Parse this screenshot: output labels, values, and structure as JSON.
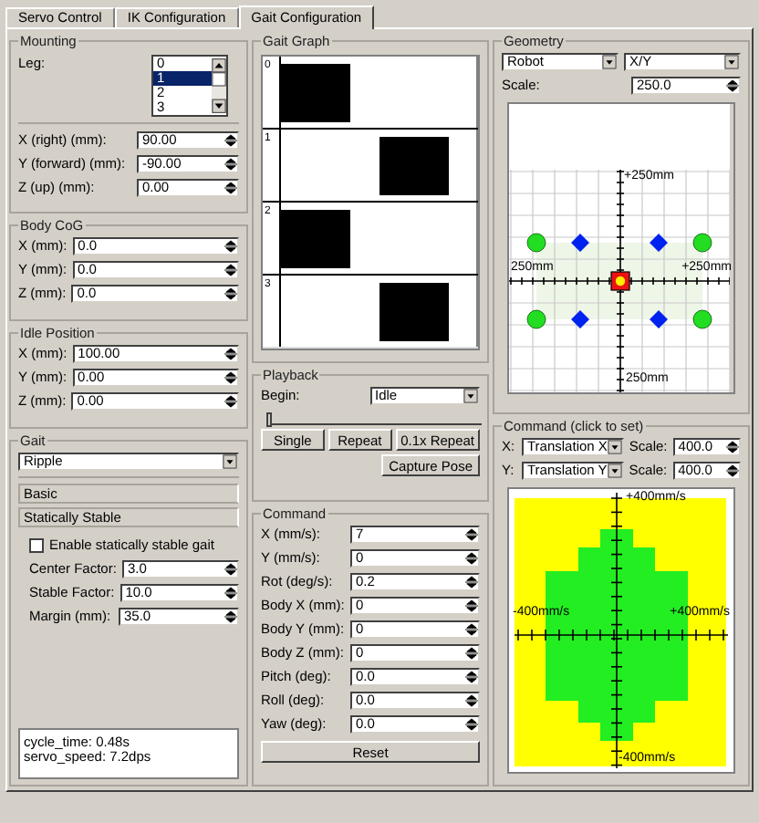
{
  "tabs": [
    {
      "label": "Servo Control",
      "selected": false
    },
    {
      "label": "IK Configuration",
      "selected": false
    },
    {
      "label": "Gait Configuration",
      "selected": true
    }
  ],
  "mounting": {
    "title": "Mounting",
    "leg_label": "Leg:",
    "legs": [
      {
        "label": "0",
        "selected": false
      },
      {
        "label": "1",
        "selected": true
      },
      {
        "label": "2",
        "selected": false
      },
      {
        "label": "3",
        "selected": false
      }
    ],
    "fields": [
      {
        "label": "X (right) (mm):",
        "value": "90.00"
      },
      {
        "label": "Y (forward) (mm):",
        "value": "-90.00"
      },
      {
        "label": "Z (up) (mm):",
        "value": "0.00"
      }
    ]
  },
  "body_cog": {
    "title": "Body CoG",
    "fields": [
      {
        "label": "X (mm):",
        "value": "0.0"
      },
      {
        "label": "Y (mm):",
        "value": "0.0"
      },
      {
        "label": "Z (mm):",
        "value": "0.0"
      }
    ]
  },
  "idle_position": {
    "title": "Idle Position",
    "fields": [
      {
        "label": "X (mm):",
        "value": "100.00"
      },
      {
        "label": "Y (mm):",
        "value": "0.00"
      },
      {
        "label": "Z (mm):",
        "value": "0.00"
      }
    ]
  },
  "gait": {
    "title": "Gait",
    "type": "Ripple",
    "sections": [
      "Basic",
      "Statically Stable"
    ],
    "checkbox": {
      "label": "Enable statically stable gait",
      "checked": false
    },
    "fields": [
      {
        "label": "Center Factor:",
        "value": "3.0"
      },
      {
        "label": "Stable Factor:",
        "value": "10.0"
      },
      {
        "label": "Margin (mm):",
        "value": "35.0"
      }
    ],
    "status": [
      "cycle_time: 0.48s",
      "servo_speed: 7.2dps"
    ]
  },
  "gait_graph": {
    "title": "Gait Graph",
    "rows": [
      {
        "label": "0",
        "leading": true
      },
      {
        "label": "1",
        "leading": false
      },
      {
        "label": "2",
        "leading": true
      },
      {
        "label": "3",
        "leading": false
      }
    ]
  },
  "playback": {
    "title": "Playback",
    "begin_label": "Begin:",
    "begin": "Idle",
    "level": 0,
    "buttons": [
      "Single",
      "Repeat",
      "0.1x Repeat"
    ],
    "capture": "Capture Pose"
  },
  "command": {
    "title": "Command",
    "fields": [
      {
        "label": "X (mm/s):",
        "value": "7"
      },
      {
        "label": "Y (mm/s):",
        "value": "0"
      },
      {
        "label": "Rot (deg/s):",
        "value": "0.2"
      },
      {
        "label": "Body X (mm):",
        "value": "0"
      },
      {
        "label": "Body Y (mm):",
        "value": "0"
      },
      {
        "label": "Body Z (mm):",
        "value": "0"
      },
      {
        "label": "Pitch (deg):",
        "value": "0.0"
      },
      {
        "label": "Roll (deg):",
        "value": "0.0"
      },
      {
        "label": "Yaw (deg):",
        "value": "0.0"
      }
    ],
    "reset": "Reset"
  },
  "geometry": {
    "title": "Geometry",
    "frame": "Robot",
    "plane": "X/Y",
    "scale_label": "Scale:",
    "scale": "250.0",
    "axis_labels": {
      "top": "+250mm",
      "left": "250mm",
      "right": "+250mm",
      "bottom": "250mm"
    }
  },
  "command_plot": {
    "title": "Command (click to set)",
    "x_label": "X:",
    "x_axis": "Translation X",
    "x_scale_label": "Scale:",
    "x_scale": "400.0",
    "y_label": "Y:",
    "y_axis": "Translation Y",
    "y_scale_label": "Scale:",
    "y_scale": "400.0",
    "axis_labels": {
      "top": "+400mm/s",
      "left": "-400mm/s",
      "right": "+400mm/s",
      "bottom": "-400mm/s"
    }
  }
}
